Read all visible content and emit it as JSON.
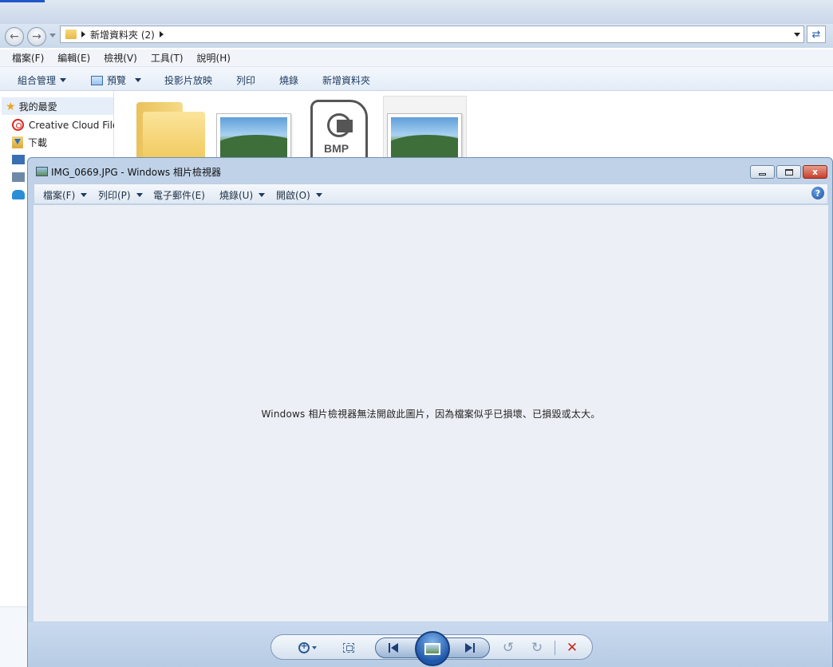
{
  "explorer": {
    "address_path": "新增資料夾 (2)",
    "menu": [
      "檔案(F)",
      "編輯(E)",
      "檢視(V)",
      "工具(T)",
      "說明(H)"
    ],
    "toolbar": {
      "organize": "組合管理",
      "preview": "預覽",
      "slideshow": "投影片放映",
      "print": "列印",
      "burn": "燒錄",
      "new_folder": "新增資料夾"
    },
    "nav": {
      "favorites": "我的最愛",
      "creative_cloud": "Creative Cloud Files",
      "downloads": "下載"
    },
    "files": {
      "bmp_label": "BMP"
    }
  },
  "viewer": {
    "title": "IMG_0669.JPG - Windows 相片檢視器",
    "menu": {
      "file": "檔案(F)",
      "print": "列印(P)",
      "email": "電子郵件(E)",
      "burn": "燒錄(U)",
      "open": "開啟(O)"
    },
    "error_message": "Windows 相片檢視器無法開啟此圖片，因為檔案似乎已損壞、已損毀或太大。",
    "controls": {
      "close_glyph": "x",
      "help_glyph": "?",
      "rotate_ccw_glyph": "↺",
      "rotate_cw_glyph": "↻",
      "delete_glyph": "✕"
    }
  },
  "colors": {
    "viewer_frame": "#bfd2e8",
    "canvas": "#ecf0f6",
    "delete_red": "#c9261b",
    "accent_blue": "#1f56a8"
  }
}
